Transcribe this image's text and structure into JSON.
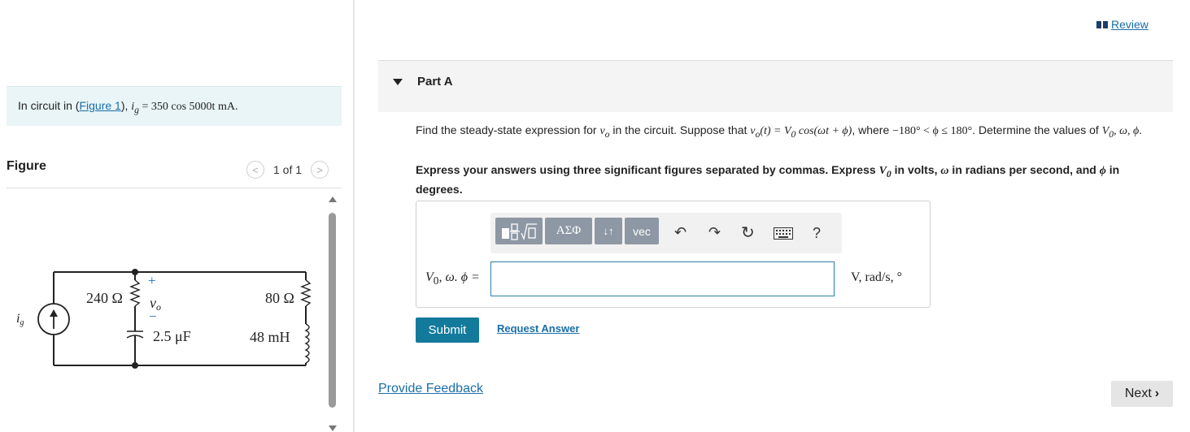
{
  "problem": {
    "prefix": "In circuit in (",
    "link": "Figure 1",
    "mid": "), ",
    "math": "i",
    "math_sub": "g",
    "math_rest": " = 350 cos 5000t mA."
  },
  "figure": {
    "title": "Figure",
    "pager": "1 of 1",
    "prev_icon": "chevron-left-icon",
    "next_icon": "chevron-right-icon",
    "circuit": {
      "r1": "240 Ω",
      "r2": "80 Ω",
      "c": "2.5 μF",
      "l": "48 mH",
      "vo": "v",
      "vo_sub": "o",
      "ig": "i",
      "ig_sub": "g",
      "plus": "+",
      "minus": "−"
    }
  },
  "review": {
    "label": "Review",
    "icon": "book-icon"
  },
  "part": {
    "title": "Part A"
  },
  "question": {
    "t1": "Find the steady-state expression for ",
    "m1": "v",
    "m1_sub": "o",
    "t2": " in the circuit. Suppose that ",
    "m2": "v",
    "m2_sub": "o",
    "m2_rest": "(t) = V",
    "m2_sub2": "0",
    "m2_rest2": " cos(ωt + ϕ)",
    "t3": ", where ",
    "m3": "−180° < ϕ ≤ 180°",
    "t4": ". Determine the values of ",
    "m4": "V",
    "m4_sub": "0",
    "m4_rest": ", ω, ϕ",
    "t5": "."
  },
  "instruction": {
    "t1": "Express your answers using three significant figures separated by commas. Express ",
    "m1": "V",
    "m1_sub": "0",
    "t2": " in volts, ",
    "m2": "ω",
    "t3": " in radians per second, and ",
    "m3": "ϕ",
    "t4": " in degrees."
  },
  "toolbar": {
    "templates": "templates-icon",
    "greek": "ΑΣΦ",
    "sort": "↓↑",
    "vec": "vec",
    "undo": "undo-icon",
    "redo": "redo-icon",
    "reset": "reset-icon",
    "keyboard": "keyboard-icon",
    "help": "?"
  },
  "answer": {
    "label_v": "V",
    "label_sub": "0",
    "label_rest": ", ω. ϕ =",
    "units": "V, rad/s, °",
    "value": ""
  },
  "buttons": {
    "submit": "Submit",
    "request_answer": "Request Answer",
    "feedback": "Provide Feedback",
    "next": "Next"
  }
}
